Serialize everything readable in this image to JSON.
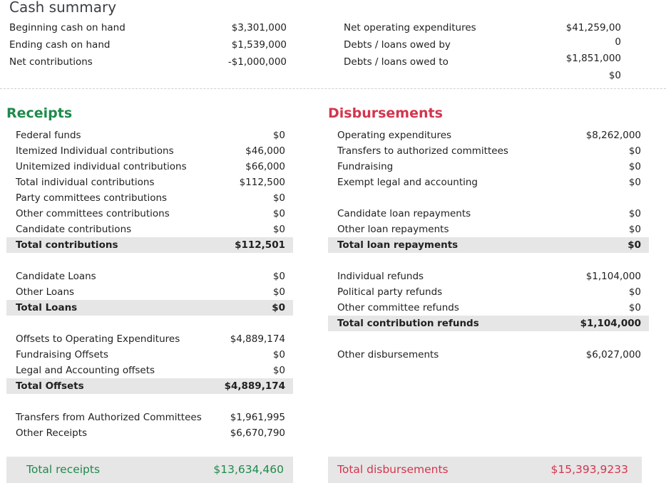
{
  "cash_summary": {
    "title": "Cash summary",
    "left": [
      {
        "label": "Beginning cash on hand",
        "value": "$3,301,000"
      },
      {
        "label": "Ending cash on hand",
        "value": "$1,539,000"
      },
      {
        "label": "Net contributions",
        "value": "-$1,000,000"
      }
    ],
    "right": {
      "labels": [
        "Net operating expenditures",
        "Debts / loans owed by",
        "Debts / loans owed to"
      ],
      "values": [
        "$41,259,00",
        "0",
        "$1,851,000",
        "$0"
      ]
    }
  },
  "receipts": {
    "heading": "Receipts",
    "rows": [
      {
        "label": "Federal funds",
        "value": "$0"
      },
      {
        "label": "Itemized Individual contributions",
        "value": "$46,000"
      },
      {
        "label": "Unitemized individual contributions",
        "value": "$66,000"
      },
      {
        "label": "Total individual contributions",
        "value": "$112,500"
      },
      {
        "label": "Party committees contributions",
        "value": "$0"
      },
      {
        "label": "Other committees contributions",
        "value": "$0"
      },
      {
        "label": "Candidate contributions",
        "value": "$0"
      },
      {
        "label": "Total contributions",
        "value": "$112,501"
      },
      {
        "label": "Candidate Loans",
        "value": "$0"
      },
      {
        "label": "Other Loans",
        "value": "$0"
      },
      {
        "label": "Total Loans",
        "value": "$0"
      },
      {
        "label": "Offsets to Operating Expenditures",
        "value": "$4,889,174"
      },
      {
        "label": "Fundraising Offsets",
        "value": "$0"
      },
      {
        "label": "Legal and Accounting offsets",
        "value": "$0"
      },
      {
        "label": "Total Offsets",
        "value": "$4,889,174"
      },
      {
        "label": "Transfers from Authorized Committees",
        "value": "$1,961,995"
      },
      {
        "label": "Other Receipts",
        "value": "$6,670,790"
      }
    ],
    "total": {
      "label": "Total receipts",
      "value": "$13,634,460"
    }
  },
  "disbursements": {
    "heading": "Disbursements",
    "rows": [
      {
        "label": "Operating expenditures",
        "value": "$8,262,000"
      },
      {
        "label": "Transfers to authorized committees",
        "value": "$0"
      },
      {
        "label": "Fundraising",
        "value": "$0"
      },
      {
        "label": "Exempt legal and accounting",
        "value": "$0"
      },
      {
        "label": "Candidate loan repayments",
        "value": "$0"
      },
      {
        "label": "Other loan repayments",
        "value": "$0"
      },
      {
        "label": "Total loan repayments",
        "value": "$0"
      },
      {
        "label": "Individual refunds",
        "value": "$1,104,000"
      },
      {
        "label": "Political party refunds",
        "value": "$0"
      },
      {
        "label": "Other committee refunds",
        "value": "$0"
      },
      {
        "label": "Total contribution refunds",
        "value": "$1,104,000"
      },
      {
        "label": "Other disbursements",
        "value": "$6,027,000"
      }
    ],
    "total": {
      "label": "Total disbursements",
      "value": "$15,393,9233"
    }
  }
}
